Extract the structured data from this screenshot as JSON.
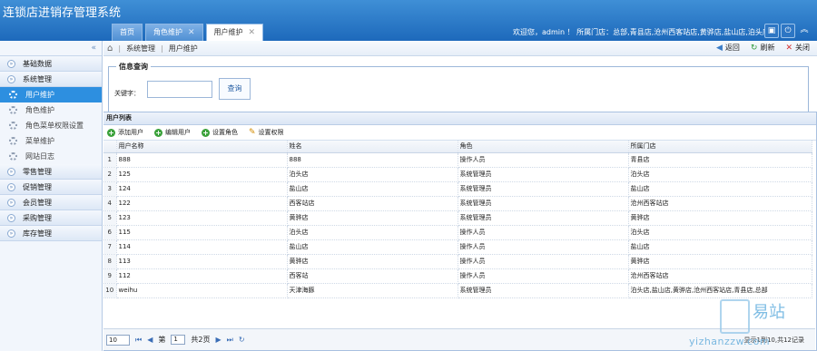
{
  "app": {
    "title": "连锁店进销存管理系统"
  },
  "tabs": [
    {
      "label": "首页",
      "active": false
    },
    {
      "label": "角色维护",
      "active": false
    },
    {
      "label": "用户维护",
      "active": true
    }
  ],
  "header": {
    "welcome": "欢迎您，admin ！ 所属门店：总部,青县店,沧州西客站店,黄骅店,盐山店,泊头店"
  },
  "sidebar": {
    "groups_top": [
      "基础数据",
      "系统管理"
    ],
    "items": [
      {
        "label": "用户维护",
        "active": true
      },
      {
        "label": "角色维护"
      },
      {
        "label": "角色菜单权限设置"
      },
      {
        "label": "菜单维护"
      },
      {
        "label": "网站日志"
      }
    ],
    "groups_bottom": [
      "零售管理",
      "促销管理",
      "会员管理",
      "采购管理",
      "库存管理"
    ]
  },
  "breadcrumb": {
    "items": [
      "系统管理",
      "用户维护"
    ]
  },
  "tools": {
    "back": "返回",
    "refresh": "刷新",
    "close": "关闭"
  },
  "query": {
    "legend": "信息查询",
    "keyword_label": "关键字：",
    "keyword_value": "",
    "button": "查询"
  },
  "list": {
    "title": "用户列表",
    "toolbar": {
      "add": "添加用户",
      "edit": "编辑用户",
      "role": "设置角色",
      "perm": "设置权限"
    },
    "columns": [
      "用户名称",
      "姓名",
      "角色",
      "所属门店"
    ],
    "rows": [
      [
        "1",
        "888",
        "888",
        "操作人员",
        "青县店"
      ],
      [
        "2",
        "125",
        "泊头店",
        "系统管理员",
        "泊头店"
      ],
      [
        "3",
        "124",
        "盐山店",
        "系统管理员",
        "盐山店"
      ],
      [
        "4",
        "122",
        "西客站店",
        "系统管理员",
        "沧州西客站店"
      ],
      [
        "5",
        "123",
        "黄骅店",
        "系统管理员",
        "黄骅店"
      ],
      [
        "6",
        "115",
        "泊头店",
        "操作人员",
        "泊头店"
      ],
      [
        "7",
        "114",
        "盐山店",
        "操作人员",
        "盐山店"
      ],
      [
        "8",
        "113",
        "黄骅店",
        "操作人员",
        "黄骅店"
      ],
      [
        "9",
        "112",
        "西客站",
        "操作人员",
        "沧州西客站店"
      ],
      [
        "10",
        "weihu",
        "天津海豚",
        "系统管理员",
        "泊头店,盐山店,黄骅店,沧州西客站店,青县店,总部"
      ]
    ]
  },
  "pager": {
    "page_size": "10",
    "page_prefix": "第",
    "current_page": "1",
    "total_pages": "共2页",
    "info": "显示1到10,共12记录"
  },
  "watermark": {
    "brand": "易站",
    "url": "yizhanzzw.com"
  }
}
